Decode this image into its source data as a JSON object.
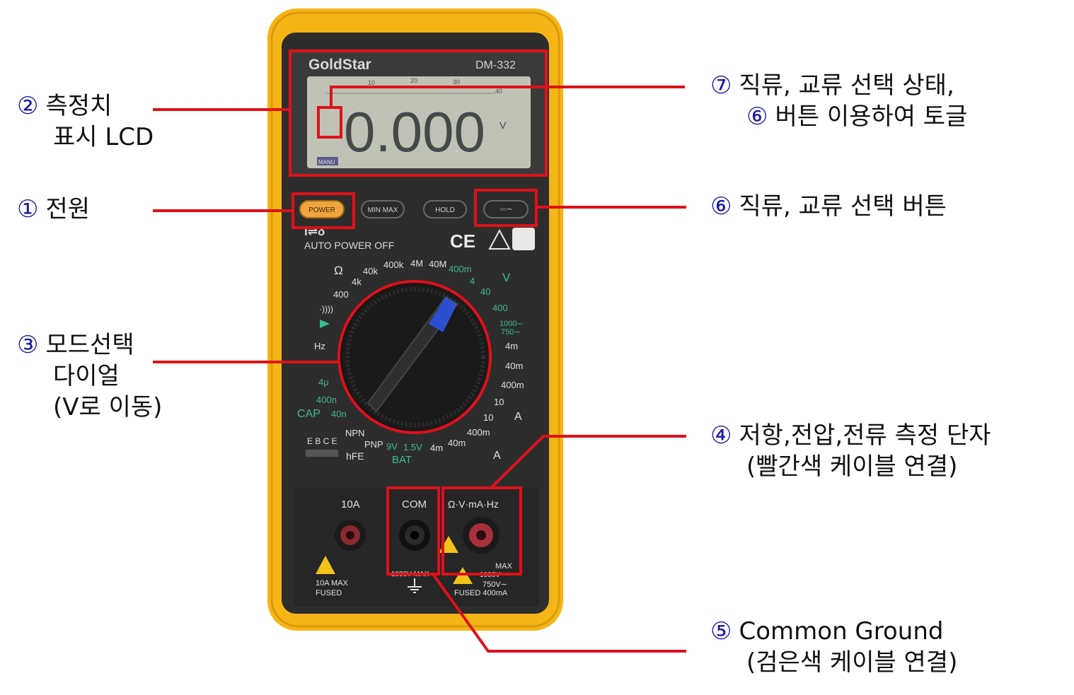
{
  "device": {
    "brand": "GoldStar",
    "model": "DM-332",
    "reading": "0.000",
    "unit": "V",
    "manu": "MANU",
    "buttons": {
      "power": "POWER",
      "minmax": "MIN MAX",
      "hold": "HOLD",
      "acdc": "⎓~"
    },
    "auto_power_off": "AUTO POWER OFF",
    "auto_power_sym": "I⇌δ",
    "bargraph_ticks": [
      "10",
      "20",
      "30",
      "40"
    ],
    "dial_labels": {
      "ohm": "Ω",
      "r400": "400",
      "r4k": "4k",
      "r40k": "40k",
      "r400k": "400k",
      "r4M": "4M",
      "r40M": "40M",
      "v400m": "400m",
      "v4": "4",
      "v40": "40",
      "v400": "400",
      "v1000": "1000⎓",
      "v750": "750∼",
      "vdc": "V",
      "a4m": "4m",
      "a40m": "40m",
      "a400m": "400m",
      "a10": "10",
      "adc": "A",
      "acA4m": "4m",
      "acA40m": "40m",
      "acA400m": "400m",
      "acA10": "10",
      "aac": "A",
      "cont": "·))))",
      "hz": "Hz",
      "c4u": "4μ",
      "c400n": "400n",
      "c40n": "40n",
      "cap": "CAP",
      "npn": "NPN",
      "pnp": "PNP",
      "bat9": "9V",
      "bat15": "1.5V",
      "bat": "BAT",
      "hfe": "hFE",
      "ebce": "E B C E"
    },
    "terminals": {
      "t10a": "10A",
      "com": "COM",
      "vohm": "Ω·V·mA·Hz",
      "fuse10": "10A  MAX",
      "fused": "FUSED",
      "max1000": "1000V   MAX",
      "max": "MAX",
      "v1000": "1000V⎓",
      "v750": "750V∼",
      "fused400": "FUSED 400mA"
    }
  },
  "callouts": [
    {
      "num": "②",
      "lines": [
        "측정치",
        "표시 LCD"
      ]
    },
    {
      "num": "①",
      "lines": [
        "전원"
      ]
    },
    {
      "num": "③",
      "lines": [
        "모드선택",
        "다이얼",
        "(V로 이동)"
      ]
    },
    {
      "num": "⑦",
      "lines": [
        "직류, 교류 선택 상태,"
      ],
      "sub_num": "⑥",
      "sub_line": "버튼 이용하여 토글"
    },
    {
      "num": "⑥",
      "lines": [
        "직류, 교류 선택 버튼"
      ]
    },
    {
      "num": "④",
      "lines": [
        "저항,전압,전류 측정 단자",
        "(빨간색 케이블 연결)"
      ]
    },
    {
      "num": "⑤",
      "lines": [
        "Common Ground",
        "(검은색 케이블 연결)"
      ]
    }
  ],
  "colors": {
    "highlight": "#e0101a",
    "case": "#f6b516",
    "body": "#2b2b2b",
    "lcd": "#bfc3b6",
    "accent_green": "#3dbb8e",
    "number": "#1a1aa8"
  }
}
